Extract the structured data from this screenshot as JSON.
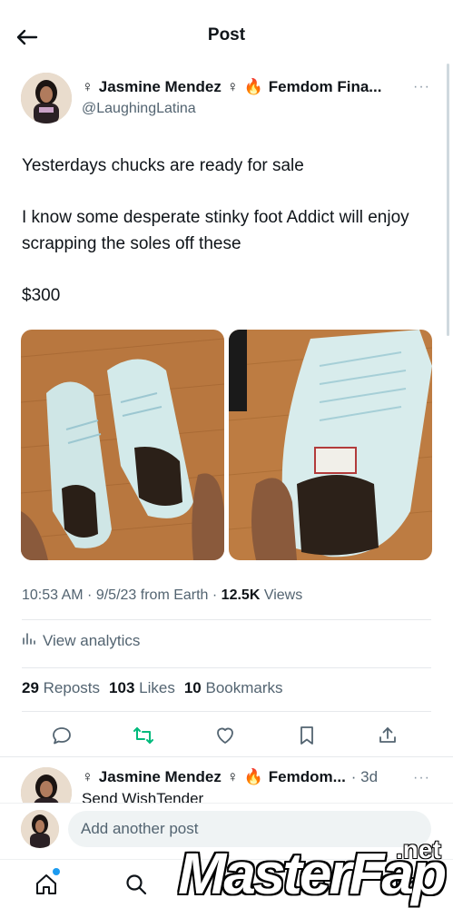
{
  "header": {
    "title": "Post"
  },
  "post": {
    "author_name": "Jasmine Mendez",
    "gender_symbol": "♀",
    "author_badge": "Femdom Fina...",
    "handle": "@LaughingLatina",
    "more": "···",
    "text": [
      "Yesterdays chucks are ready for sale",
      "I know some desperate stinky foot Addict will enjoy scrapping the soles off these",
      "$300"
    ],
    "meta": {
      "time": "10:53 AM",
      "date": "9/5/23",
      "source": "from Earth",
      "views_count": "12.5K",
      "views_label": "Views"
    },
    "analytics_label": "View analytics",
    "stats": {
      "reposts_count": "29",
      "reposts_label": "Reposts",
      "likes_count": "103",
      "likes_label": "Likes",
      "bookmarks_count": "10",
      "bookmarks_label": "Bookmarks"
    }
  },
  "reply": {
    "author_name": "Jasmine Mendez",
    "gender_symbol": "♀",
    "author_badge": "Femdom...",
    "time": "· 3d",
    "more": "···",
    "text": "Send WishTender"
  },
  "compose": {
    "placeholder": "Add another post"
  },
  "watermark": {
    "main": "MasterFap",
    "suffix": ".net"
  },
  "colors": {
    "accent": "#1d9bf0",
    "repost_green": "#00ba7c",
    "muted": "#536471"
  }
}
